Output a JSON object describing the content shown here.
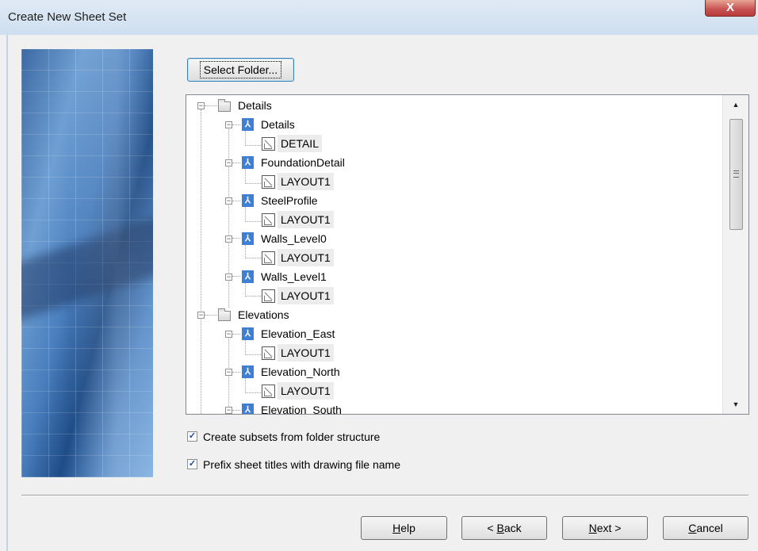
{
  "window": {
    "title": "Create New Sheet Set",
    "close_glyph": "X"
  },
  "select_folder_label": "Select Folder...",
  "tree": {
    "details_folder": "Details",
    "details_file": "Details",
    "detail_sheet": "DETAIL",
    "foundation_file": "FoundationDetail",
    "foundation_sheet": "LAYOUT1",
    "steel_file": "SteelProfile",
    "steel_sheet": "LAYOUT1",
    "walls0_file": "Walls_Level0",
    "walls0_sheet": "LAYOUT1",
    "walls1_file": "Walls_Level1",
    "walls1_sheet": "LAYOUT1",
    "elevations_folder": "Elevations",
    "east_file": "Elevation_East",
    "east_sheet": "LAYOUT1",
    "north_file": "Elevation_North",
    "north_sheet": "LAYOUT1",
    "south_file": "Elevation_South"
  },
  "options": {
    "create_subsets": {
      "label": "Create subsets from folder structure",
      "checked": true
    },
    "prefix_titles": {
      "label": "Prefix sheet titles with drawing file name",
      "checked": true
    }
  },
  "buttons": {
    "help": {
      "mnemonic": "H",
      "rest": "elp"
    },
    "back": {
      "pre": "< ",
      "mnemonic": "B",
      "rest": "ack"
    },
    "next": {
      "mnemonic": "N",
      "rest": "ext >"
    },
    "cancel": {
      "mnemonic": "C",
      "rest": "ancel"
    }
  },
  "icons": {
    "folder": "folder-icon",
    "drawing": "dwg-file-icon",
    "layout": "layout-sheet-icon",
    "checkmark": "✓",
    "scroll_up": "▲",
    "scroll_down": "▼"
  },
  "colors": {
    "dwg_icon": "#3d7fd4",
    "close_button": "#c75050",
    "title_bar": "#dfe9f5"
  }
}
